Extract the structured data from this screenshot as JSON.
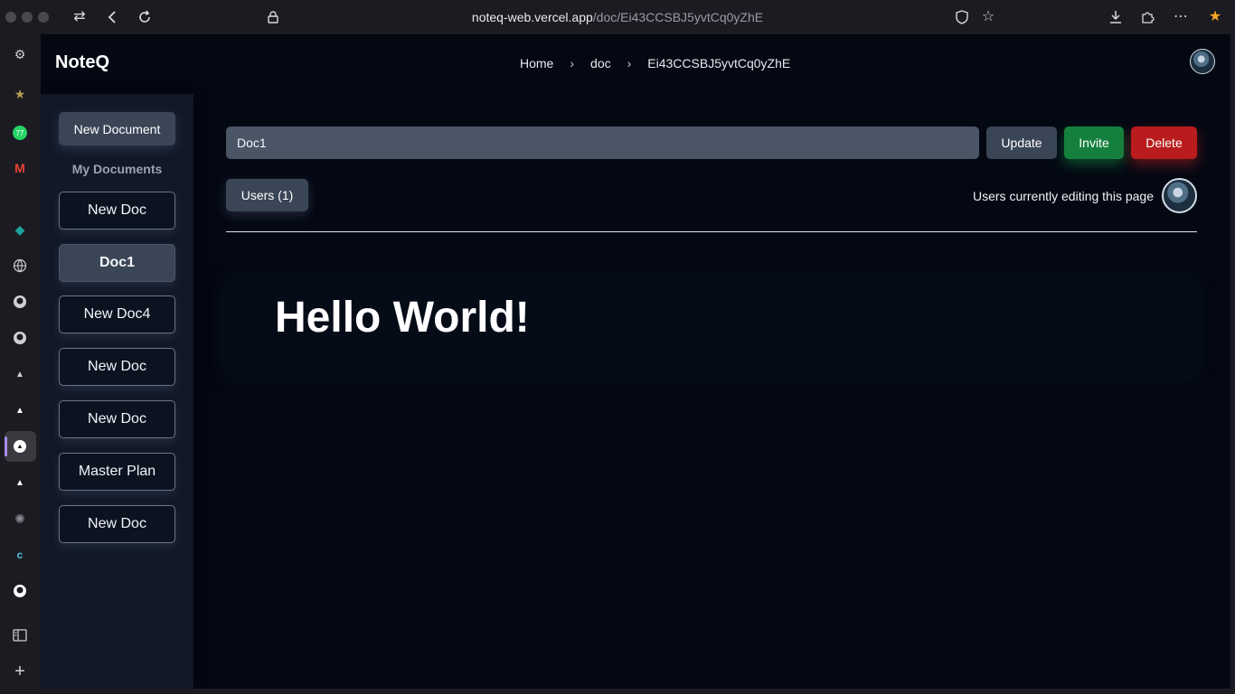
{
  "browser": {
    "url_host": "noteq-web.vercel.app",
    "url_path": "/doc/Ei43CCSBJ5yvtCq0yZhE",
    "whatsapp_badge": "77",
    "icons": {
      "back": "back-icon",
      "swap": "swap-icon",
      "reload": "reload-icon",
      "lock": "lock-icon",
      "shield": "shield-icon",
      "bookmark": "star-icon",
      "downloads": "download-icon",
      "extensions": "puzzle-icon",
      "menu": "more-icon"
    }
  },
  "app": {
    "brand": "NoteQ",
    "breadcrumb": [
      "Home",
      "doc",
      "Ei43CCSBJ5yvtCq0yZhE"
    ],
    "sidebar": {
      "new_document": "New Document",
      "my_documents": "My Documents",
      "documents": [
        {
          "label": "New Doc",
          "active": false
        },
        {
          "label": "Doc1",
          "active": true
        },
        {
          "label": "New Doc4",
          "active": false
        },
        {
          "label": "New Doc",
          "active": false
        },
        {
          "label": "New Doc",
          "active": false
        },
        {
          "label": "Master Plan",
          "active": false
        },
        {
          "label": "New Doc",
          "active": false
        }
      ]
    },
    "toolbar": {
      "title_value": "Doc1",
      "update_label": "Update",
      "invite_label": "Invite",
      "delete_label": "Delete",
      "users_label": "Users (1)",
      "editing_label": "Users currently editing this page"
    },
    "editor": {
      "heading": "Hello World!"
    },
    "colors": {
      "background": "#040813",
      "sidebar": "#111827",
      "invite": "#15803d",
      "delete": "#b91c1c"
    }
  }
}
